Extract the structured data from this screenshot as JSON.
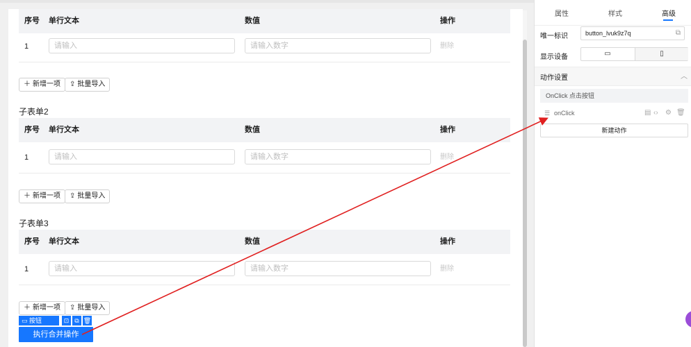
{
  "canvas": {
    "tables": [
      {
        "subtitle": "",
        "headers": {
          "index": "序号",
          "text": "单行文本",
          "number": "数值",
          "ops": "操作"
        },
        "row": {
          "index": "1",
          "text_placeholder": "请输入",
          "number_placeholder": "请输入数字",
          "delete": "删除"
        },
        "add_label": "新增一项",
        "import_label": "批量导入"
      },
      {
        "subtitle": "子表单2",
        "headers": {
          "index": "序号",
          "text": "单行文本",
          "number": "数值",
          "ops": "操作"
        },
        "row": {
          "index": "1",
          "text_placeholder": "请输入",
          "number_placeholder": "请输入数字",
          "delete": "删除"
        },
        "add_label": "新增一项",
        "import_label": "批量导入"
      },
      {
        "subtitle": "子表单3",
        "headers": {
          "index": "序号",
          "text": "单行文本",
          "number": "数值",
          "ops": "操作"
        },
        "row": {
          "index": "1",
          "text_placeholder": "请输入",
          "number_placeholder": "请输入数字",
          "delete": "删除"
        },
        "add_label": "新增一项",
        "import_label": "批量导入"
      }
    ],
    "selection_tag": "按钮",
    "execute_button": "执行合并操作"
  },
  "panel": {
    "tabs": [
      "属性",
      "样式",
      "高级"
    ],
    "active_tab": "高级",
    "unique_id_label": "唯一标识",
    "unique_id_value": "button_lvuk9z7q",
    "display_device_label": "显示设备",
    "action_section_title": "动作设置",
    "onclick_bar": "OnClick 点击按钮",
    "action_name": "onClick",
    "new_action": "新建动作"
  },
  "colors": {
    "primary": "#1677ff",
    "arrow": "#e02020",
    "header_bg": "#f2f3f5",
    "avatar": "#9b4dd8"
  }
}
